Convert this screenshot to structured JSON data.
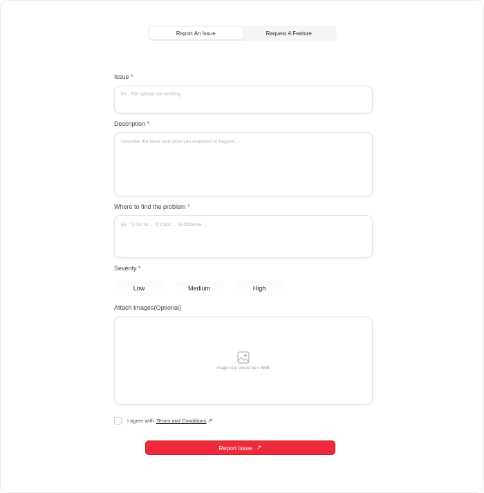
{
  "tabs": [
    {
      "label": "Report An Issue",
      "active": true
    },
    {
      "label": "Request A Feature",
      "active": false
    }
  ],
  "issue": {
    "label": "Issue",
    "required": "*",
    "placeholder": "Ex : File upload not working."
  },
  "description": {
    "label": "Description",
    "required": "*",
    "placeholder": "Describe the issue and what you expected to happen."
  },
  "location": {
    "label": "Where to find the problem",
    "required": "*",
    "placeholder": "Ex : 1) Go to ... 2) Click ... 3) Observe ..."
  },
  "severity": {
    "label": "Severity",
    "required": "*",
    "options": [
      "Low",
      "Medium",
      "High"
    ]
  },
  "attach": {
    "label": "Attach  Images(Optional)",
    "hint": "Image size should be < 5MB",
    "icon": "image-icon"
  },
  "agreement": {
    "text": "I agree with",
    "link": "Terms and Conditions",
    "link_icon": "↗"
  },
  "submit": {
    "label": "Report Issue",
    "icon": "↗"
  },
  "colors": {
    "accent": "#ee2b3d",
    "required": "#e8293a"
  }
}
